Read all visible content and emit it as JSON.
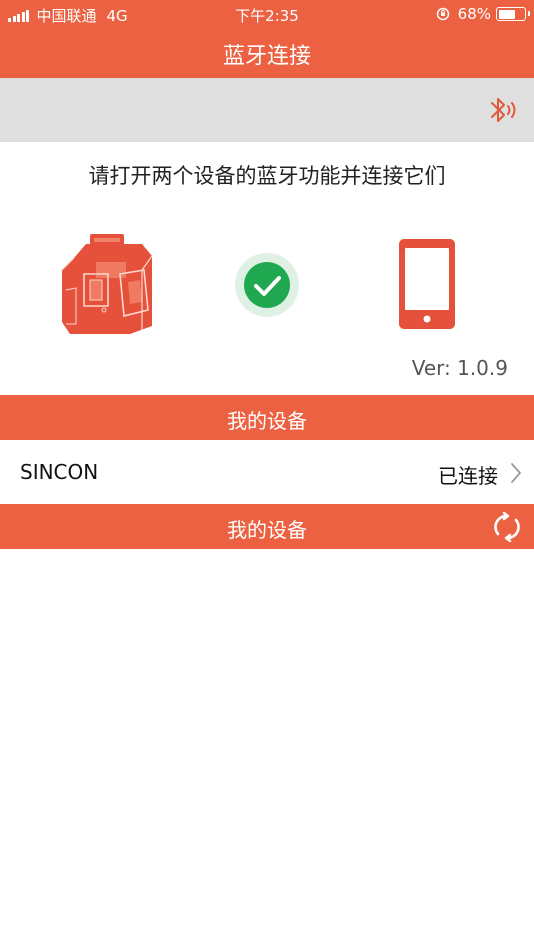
{
  "status_bar": {
    "carrier": "中国联通",
    "network": "4G",
    "time": "下午2:35",
    "battery": "68%",
    "battery_level": 0.68
  },
  "nav": {
    "title": "蓝牙连接"
  },
  "instruction": "请打开两个设备的蓝牙功能并连接它们",
  "version": "Ver: 1.0.9",
  "sections": [
    {
      "label": "我的设备"
    },
    {
      "label": "我的设备"
    }
  ],
  "devices": [
    {
      "name": "SINCON",
      "status": "已连接"
    }
  ],
  "colors": {
    "accent": "#EC6142",
    "gray_bar": "#DFDFDF",
    "check_green": "#1FA84F"
  },
  "icons": [
    "bluetooth-icon",
    "check-icon",
    "phone-icon",
    "chevron-right-icon",
    "refresh-icon"
  ]
}
